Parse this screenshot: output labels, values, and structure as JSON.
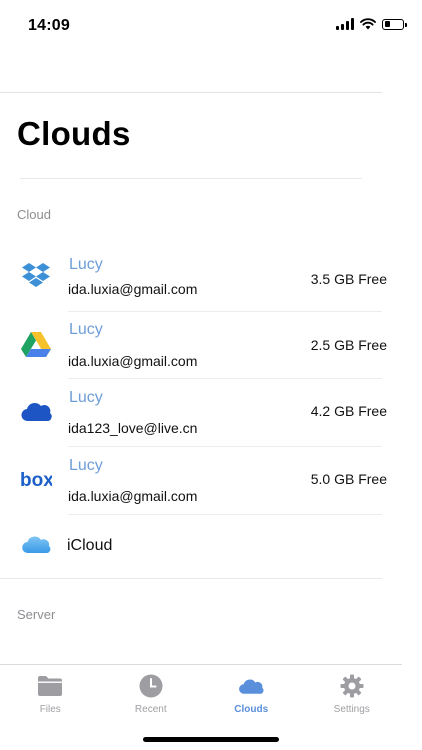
{
  "status_bar": {
    "time": "14:09"
  },
  "page": {
    "title": "Clouds"
  },
  "sections": {
    "cloud_header": "Cloud",
    "server_header": "Server"
  },
  "accounts": [
    {
      "service": "dropbox",
      "icon": "dropbox-icon",
      "name": "Lucy",
      "email": "ida.luxia@gmail.com",
      "free": "3.5 GB Free"
    },
    {
      "service": "google-drive",
      "icon": "google-drive-icon",
      "name": "Lucy",
      "email": "ida.luxia@gmail.com",
      "free": "2.5 GB Free"
    },
    {
      "service": "onedrive",
      "icon": "onedrive-icon",
      "name": "Lucy",
      "email": "ida123_love@live.cn",
      "free": "4.2 GB Free"
    },
    {
      "service": "box",
      "icon": "box-icon",
      "name": "Lucy",
      "email": "ida.luxia@gmail.com",
      "free": "5.0 GB Free"
    }
  ],
  "icloud": {
    "label": "iCloud",
    "icon": "icloud-icon"
  },
  "tabs": [
    {
      "label": "Files",
      "icon": "folder-icon",
      "active": false
    },
    {
      "label": "Recent",
      "icon": "clock-icon",
      "active": false
    },
    {
      "label": "Clouds",
      "icon": "cloud-icon",
      "active": true
    },
    {
      "label": "Settings",
      "icon": "gear-icon",
      "active": false
    }
  ],
  "colors": {
    "accent": "#5a8fdb",
    "account_name": "#6e9ed8",
    "inactive_tab": "#a0a0a4",
    "section_header": "#8e8e93"
  }
}
